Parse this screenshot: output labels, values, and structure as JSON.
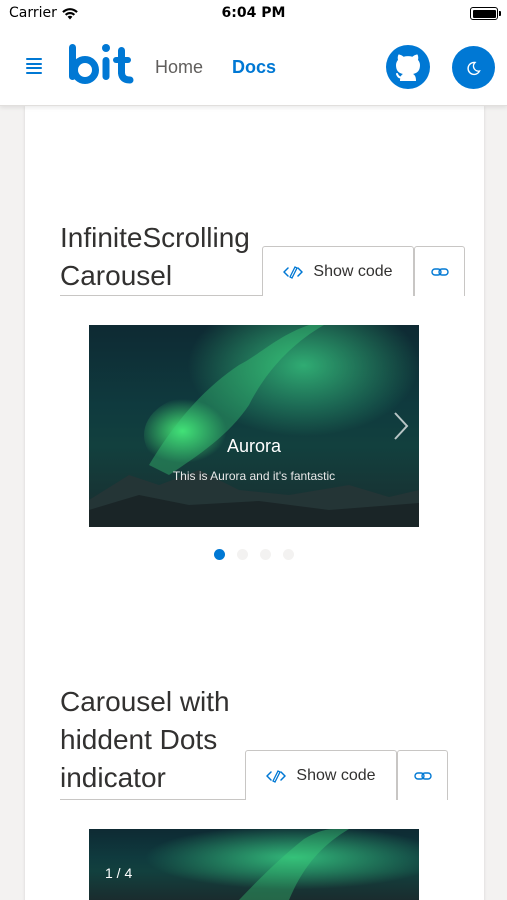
{
  "status_bar": {
    "carrier": "Carrier",
    "time": "6:04 PM"
  },
  "header": {
    "logo_text": "bit",
    "nav": [
      {
        "label": "Home",
        "active": false
      },
      {
        "label": "Docs",
        "active": true
      }
    ],
    "accent_color": "#0078d4"
  },
  "sections": [
    {
      "title_line1": "InfiniteScrolling",
      "title_line2": "Carousel",
      "show_code_label": "Show code",
      "slide": {
        "title": "Aurora",
        "subtitle": "This is Aurora and it's fantastic"
      },
      "dots": {
        "count": 4,
        "active_index": 0
      }
    },
    {
      "title_line1": "Carousel with",
      "title_line2": "hiddent Dots",
      "title_line3": "indicator",
      "show_code_label": "Show code",
      "slide": {
        "counter": "1 / 4"
      }
    }
  ],
  "icons": {
    "menu": "hamburger-menu-icon",
    "github": "github-icon",
    "theme": "moon-icon",
    "code": "code-edit-icon",
    "link": "link-icon",
    "next": "chevron-right-icon"
  }
}
